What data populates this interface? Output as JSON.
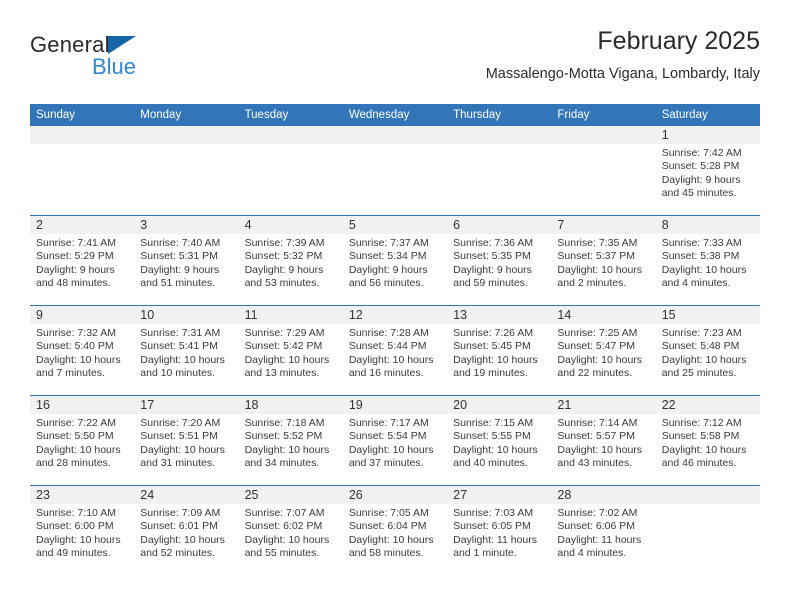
{
  "brand": {
    "name_part1": "General",
    "name_part2": "Blue",
    "triangle_color": "#1565a8",
    "blue_color": "#2f86d4"
  },
  "header": {
    "title": "February 2025",
    "subtitle": "Massalengo-Motta Vigana, Lombardy, Italy"
  },
  "theme": {
    "header_bg": "#3275b8",
    "daynum_bg": "#f1f1f1",
    "row_divider": "#3275b8",
    "text": "#3a3a3a"
  },
  "weekday_headers": [
    "Sunday",
    "Monday",
    "Tuesday",
    "Wednesday",
    "Thursday",
    "Friday",
    "Saturday"
  ],
  "weeks": [
    [
      {
        "day": ""
      },
      {
        "day": ""
      },
      {
        "day": ""
      },
      {
        "day": ""
      },
      {
        "day": ""
      },
      {
        "day": ""
      },
      {
        "day": "1",
        "sunrise": "Sunrise: 7:42 AM",
        "sunset": "Sunset: 5:28 PM",
        "daylight_line1": "Daylight: 9 hours",
        "daylight_line2": "and 45 minutes."
      }
    ],
    [
      {
        "day": "2",
        "sunrise": "Sunrise: 7:41 AM",
        "sunset": "Sunset: 5:29 PM",
        "daylight_line1": "Daylight: 9 hours",
        "daylight_line2": "and 48 minutes."
      },
      {
        "day": "3",
        "sunrise": "Sunrise: 7:40 AM",
        "sunset": "Sunset: 5:31 PM",
        "daylight_line1": "Daylight: 9 hours",
        "daylight_line2": "and 51 minutes."
      },
      {
        "day": "4",
        "sunrise": "Sunrise: 7:39 AM",
        "sunset": "Sunset: 5:32 PM",
        "daylight_line1": "Daylight: 9 hours",
        "daylight_line2": "and 53 minutes."
      },
      {
        "day": "5",
        "sunrise": "Sunrise: 7:37 AM",
        "sunset": "Sunset: 5:34 PM",
        "daylight_line1": "Daylight: 9 hours",
        "daylight_line2": "and 56 minutes."
      },
      {
        "day": "6",
        "sunrise": "Sunrise: 7:36 AM",
        "sunset": "Sunset: 5:35 PM",
        "daylight_line1": "Daylight: 9 hours",
        "daylight_line2": "and 59 minutes."
      },
      {
        "day": "7",
        "sunrise": "Sunrise: 7:35 AM",
        "sunset": "Sunset: 5:37 PM",
        "daylight_line1": "Daylight: 10 hours",
        "daylight_line2": "and 2 minutes."
      },
      {
        "day": "8",
        "sunrise": "Sunrise: 7:33 AM",
        "sunset": "Sunset: 5:38 PM",
        "daylight_line1": "Daylight: 10 hours",
        "daylight_line2": "and 4 minutes."
      }
    ],
    [
      {
        "day": "9",
        "sunrise": "Sunrise: 7:32 AM",
        "sunset": "Sunset: 5:40 PM",
        "daylight_line1": "Daylight: 10 hours",
        "daylight_line2": "and 7 minutes."
      },
      {
        "day": "10",
        "sunrise": "Sunrise: 7:31 AM",
        "sunset": "Sunset: 5:41 PM",
        "daylight_line1": "Daylight: 10 hours",
        "daylight_line2": "and 10 minutes."
      },
      {
        "day": "11",
        "sunrise": "Sunrise: 7:29 AM",
        "sunset": "Sunset: 5:42 PM",
        "daylight_line1": "Daylight: 10 hours",
        "daylight_line2": "and 13 minutes."
      },
      {
        "day": "12",
        "sunrise": "Sunrise: 7:28 AM",
        "sunset": "Sunset: 5:44 PM",
        "daylight_line1": "Daylight: 10 hours",
        "daylight_line2": "and 16 minutes."
      },
      {
        "day": "13",
        "sunrise": "Sunrise: 7:26 AM",
        "sunset": "Sunset: 5:45 PM",
        "daylight_line1": "Daylight: 10 hours",
        "daylight_line2": "and 19 minutes."
      },
      {
        "day": "14",
        "sunrise": "Sunrise: 7:25 AM",
        "sunset": "Sunset: 5:47 PM",
        "daylight_line1": "Daylight: 10 hours",
        "daylight_line2": "and 22 minutes."
      },
      {
        "day": "15",
        "sunrise": "Sunrise: 7:23 AM",
        "sunset": "Sunset: 5:48 PM",
        "daylight_line1": "Daylight: 10 hours",
        "daylight_line2": "and 25 minutes."
      }
    ],
    [
      {
        "day": "16",
        "sunrise": "Sunrise: 7:22 AM",
        "sunset": "Sunset: 5:50 PM",
        "daylight_line1": "Daylight: 10 hours",
        "daylight_line2": "and 28 minutes."
      },
      {
        "day": "17",
        "sunrise": "Sunrise: 7:20 AM",
        "sunset": "Sunset: 5:51 PM",
        "daylight_line1": "Daylight: 10 hours",
        "daylight_line2": "and 31 minutes."
      },
      {
        "day": "18",
        "sunrise": "Sunrise: 7:18 AM",
        "sunset": "Sunset: 5:52 PM",
        "daylight_line1": "Daylight: 10 hours",
        "daylight_line2": "and 34 minutes."
      },
      {
        "day": "19",
        "sunrise": "Sunrise: 7:17 AM",
        "sunset": "Sunset: 5:54 PM",
        "daylight_line1": "Daylight: 10 hours",
        "daylight_line2": "and 37 minutes."
      },
      {
        "day": "20",
        "sunrise": "Sunrise: 7:15 AM",
        "sunset": "Sunset: 5:55 PM",
        "daylight_line1": "Daylight: 10 hours",
        "daylight_line2": "and 40 minutes."
      },
      {
        "day": "21",
        "sunrise": "Sunrise: 7:14 AM",
        "sunset": "Sunset: 5:57 PM",
        "daylight_line1": "Daylight: 10 hours",
        "daylight_line2": "and 43 minutes."
      },
      {
        "day": "22",
        "sunrise": "Sunrise: 7:12 AM",
        "sunset": "Sunset: 5:58 PM",
        "daylight_line1": "Daylight: 10 hours",
        "daylight_line2": "and 46 minutes."
      }
    ],
    [
      {
        "day": "23",
        "sunrise": "Sunrise: 7:10 AM",
        "sunset": "Sunset: 6:00 PM",
        "daylight_line1": "Daylight: 10 hours",
        "daylight_line2": "and 49 minutes."
      },
      {
        "day": "24",
        "sunrise": "Sunrise: 7:09 AM",
        "sunset": "Sunset: 6:01 PM",
        "daylight_line1": "Daylight: 10 hours",
        "daylight_line2": "and 52 minutes."
      },
      {
        "day": "25",
        "sunrise": "Sunrise: 7:07 AM",
        "sunset": "Sunset: 6:02 PM",
        "daylight_line1": "Daylight: 10 hours",
        "daylight_line2": "and 55 minutes."
      },
      {
        "day": "26",
        "sunrise": "Sunrise: 7:05 AM",
        "sunset": "Sunset: 6:04 PM",
        "daylight_line1": "Daylight: 10 hours",
        "daylight_line2": "and 58 minutes."
      },
      {
        "day": "27",
        "sunrise": "Sunrise: 7:03 AM",
        "sunset": "Sunset: 6:05 PM",
        "daylight_line1": "Daylight: 11 hours",
        "daylight_line2": "and 1 minute."
      },
      {
        "day": "28",
        "sunrise": "Sunrise: 7:02 AM",
        "sunset": "Sunset: 6:06 PM",
        "daylight_line1": "Daylight: 11 hours",
        "daylight_line2": "and 4 minutes."
      },
      {
        "day": ""
      }
    ]
  ]
}
